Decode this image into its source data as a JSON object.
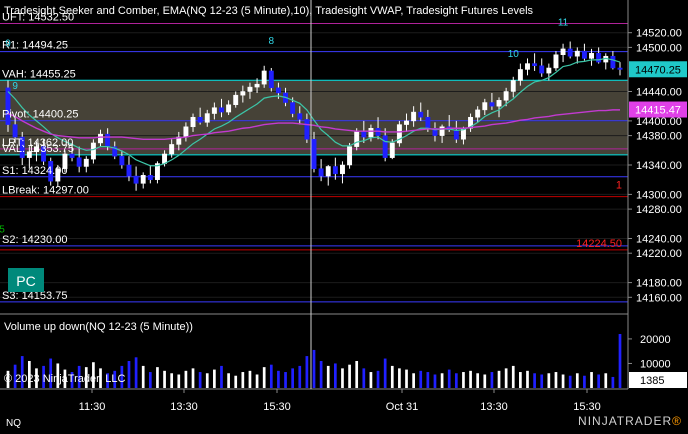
{
  "header": {
    "indicators": "Tradesight Seeker and Comber, EMA(NQ 12-23 (5 Minute),10), Tradesight VWAP, Tradesight Futures Levels"
  },
  "levels": [
    {
      "label": "UFT: 14532.50",
      "value": 14532.5,
      "color": "#b0229a"
    },
    {
      "label": "R1: 14494.25",
      "value": 14494.25,
      "color": "#3b3bff"
    },
    {
      "label": "VAH: 14455.25",
      "value": 14455.25,
      "color": "#00e5e5"
    },
    {
      "label": "Pivot: 14400.25",
      "value": 14400.25,
      "color": "#3b3bff"
    },
    {
      "label": "LRT: 14362.00",
      "value": 14362.0,
      "color": "#b0229a"
    },
    {
      "label": "VAL: 14353.75",
      "value": 14353.75,
      "color": "#00e5e5"
    },
    {
      "label": "S1: 14324.00",
      "value": 14324.0,
      "color": "#3b3bff"
    },
    {
      "label": "LBreak: 14297.00",
      "value": 14297.0,
      "color": "#c00000"
    },
    {
      "label": "S2: 14230.00",
      "value": 14230.0,
      "color": "#3b3bff"
    },
    {
      "label": "S3: 14153.75",
      "value": 14153.75,
      "color": "#3b3bff"
    }
  ],
  "price_axis": {
    "ticks": [
      "14520.00",
      "14500.00",
      "14440.00",
      "14400.00",
      "14380.00",
      "14340.00",
      "14300.00",
      "14280.00",
      "14240.00",
      "14220.00",
      "14180.00",
      "14160.00"
    ],
    "tick_values": [
      14520,
      14500,
      14440,
      14400,
      14380,
      14340,
      14300,
      14280,
      14240,
      14220,
      14180,
      14160
    ],
    "last_price_label": "14470.25",
    "last_price": 14470.25,
    "vwap_label": "14415.47",
    "vwap_value": 14415.47,
    "ylim": [
      14140,
      14540
    ]
  },
  "annotations": {
    "red_level_label": "14224.50",
    "red_level_value": 14224.5,
    "red_marker": "1",
    "counts": [
      "8",
      "10",
      "11",
      "9",
      "5",
      "9"
    ]
  },
  "volume_panel": {
    "title": "Volume up down(NQ 12-23 (5 Minute))",
    "ticks": [
      "20000",
      "10000"
    ],
    "tick_values": [
      20000,
      10000
    ],
    "last_volume": "1385",
    "ylim": [
      0,
      22000
    ]
  },
  "time_axis": {
    "labels": [
      "11:30",
      "13:30",
      "15:30",
      "Oct 31",
      "13:30",
      "15:30"
    ]
  },
  "footer": {
    "copyright": "© 2023 NinjaTrader, LLC",
    "instrument": "NQ",
    "logo_main": "NINJATRADER",
    "logo_mark": "®"
  },
  "buttons": {
    "pc": "PC"
  },
  "chart_data": {
    "type": "candlestick",
    "ylim": [
      14140,
      14540
    ],
    "ohlc": [
      [
        14445,
        14455,
        14385,
        14395
      ],
      [
        14395,
        14405,
        14370,
        14378
      ],
      [
        14378,
        14385,
        14340,
        14350
      ],
      [
        14350,
        14365,
        14335,
        14358
      ],
      [
        14358,
        14372,
        14345,
        14365
      ],
      [
        14365,
        14375,
        14340,
        14345
      ],
      [
        14345,
        14350,
        14312,
        14318
      ],
      [
        14318,
        14340,
        14310,
        14335
      ],
      [
        14335,
        14360,
        14330,
        14355
      ],
      [
        14355,
        14370,
        14345,
        14350
      ],
      [
        14350,
        14365,
        14330,
        14338
      ],
      [
        14338,
        14352,
        14330,
        14348
      ],
      [
        14348,
        14375,
        14342,
        14370
      ],
      [
        14370,
        14388,
        14365,
        14382
      ],
      [
        14382,
        14390,
        14360,
        14365
      ],
      [
        14365,
        14372,
        14348,
        14352
      ],
      [
        14352,
        14360,
        14335,
        14340
      ],
      [
        14340,
        14352,
        14318,
        14325
      ],
      [
        14325,
        14338,
        14305,
        14315
      ],
      [
        14315,
        14330,
        14308,
        14326
      ],
      [
        14326,
        14340,
        14315,
        14320
      ],
      [
        14320,
        14345,
        14315,
        14342
      ],
      [
        14342,
        14360,
        14338,
        14355
      ],
      [
        14355,
        14375,
        14350,
        14368
      ],
      [
        14368,
        14385,
        14360,
        14378
      ],
      [
        14378,
        14398,
        14372,
        14392
      ],
      [
        14392,
        14410,
        14385,
        14405
      ],
      [
        14405,
        14418,
        14395,
        14398
      ],
      [
        14398,
        14415,
        14392,
        14410
      ],
      [
        14410,
        14425,
        14402,
        14418
      ],
      [
        14418,
        14430,
        14405,
        14412
      ],
      [
        14412,
        14428,
        14408,
        14422
      ],
      [
        14422,
        14440,
        14418,
        14435
      ],
      [
        14435,
        14448,
        14425,
        14440
      ],
      [
        14440,
        14452,
        14430,
        14446
      ],
      [
        14446,
        14458,
        14438,
        14450
      ],
      [
        14450,
        14475,
        14445,
        14468
      ],
      [
        14468,
        14472,
        14440,
        14445
      ],
      [
        14445,
        14452,
        14430,
        14438
      ],
      [
        14438,
        14445,
        14420,
        14425
      ],
      [
        14425,
        14432,
        14405,
        14410
      ],
      [
        14410,
        14420,
        14395,
        14402
      ],
      [
        14402,
        14410,
        14370,
        14375
      ],
      [
        14375,
        14385,
        14330,
        14335
      ],
      [
        14335,
        14348,
        14318,
        14325
      ],
      [
        14325,
        14340,
        14312,
        14338
      ],
      [
        14338,
        14350,
        14320,
        14328
      ],
      [
        14328,
        14345,
        14315,
        14340
      ],
      [
        14340,
        14370,
        14335,
        14365
      ],
      [
        14365,
        14390,
        14360,
        14385
      ],
      [
        14385,
        14400,
        14370,
        14378
      ],
      [
        14378,
        14395,
        14372,
        14390
      ],
      [
        14390,
        14405,
        14375,
        14380
      ],
      [
        14380,
        14390,
        14345,
        14350
      ],
      [
        14350,
        14375,
        14348,
        14370
      ],
      [
        14370,
        14400,
        14365,
        14395
      ],
      [
        14395,
        14410,
        14385,
        14400
      ],
      [
        14400,
        14420,
        14392,
        14412
      ],
      [
        14412,
        14425,
        14400,
        14405
      ],
      [
        14405,
        14415,
        14385,
        14390
      ],
      [
        14390,
        14398,
        14372,
        14380
      ],
      [
        14380,
        14395,
        14370,
        14392
      ],
      [
        14392,
        14408,
        14385,
        14388
      ],
      [
        14388,
        14400,
        14370,
        14375
      ],
      [
        14375,
        14392,
        14368,
        14390
      ],
      [
        14390,
        14410,
        14385,
        14405
      ],
      [
        14405,
        14420,
        14398,
        14415
      ],
      [
        14415,
        14430,
        14408,
        14425
      ],
      [
        14425,
        14438,
        14415,
        14420
      ],
      [
        14420,
        14432,
        14405,
        14428
      ],
      [
        14428,
        14445,
        14420,
        14440
      ],
      [
        14440,
        14460,
        14432,
        14455
      ],
      [
        14455,
        14478,
        14448,
        14470
      ],
      [
        14470,
        14485,
        14462,
        14478
      ],
      [
        14478,
        14492,
        14468,
        14475
      ],
      [
        14475,
        14485,
        14460,
        14465
      ],
      [
        14465,
        14478,
        14455,
        14472
      ],
      [
        14472,
        14495,
        14468,
        14490
      ],
      [
        14490,
        14505,
        14480,
        14498
      ],
      [
        14498,
        14508,
        14485,
        14488
      ],
      [
        14488,
        14500,
        14478,
        14495
      ],
      [
        14495,
        14505,
        14482,
        14485
      ],
      [
        14485,
        14498,
        14475,
        14492
      ],
      [
        14492,
        14500,
        14478,
        14480
      ],
      [
        14480,
        14492,
        14470,
        14488
      ],
      [
        14488,
        14495,
        14470,
        14472
      ],
      [
        14472,
        14480,
        14462,
        14470
      ]
    ],
    "ema": [
      14440,
      14430,
      14418,
      14408,
      14400,
      14392,
      14383,
      14377,
      14372,
      14368,
      14363,
      14360,
      14361,
      14365,
      14365,
      14363,
      14359,
      14354,
      14347,
      14343,
      14339,
      14339,
      14342,
      14347,
      14353,
      14361,
      14369,
      14375,
      14382,
      14389,
      14393,
      14398,
      14405,
      14411,
      14417,
      14423,
      14431,
      14433,
      14434,
      14432,
      14428,
      14424,
      14415,
      14401,
      14388,
      14380,
      14371,
      14366,
      14366,
      14371,
      14373,
      14377,
      14378,
      14372,
      14371,
      14375,
      14380,
      14386,
      14390,
      14390,
      14388,
      14389,
      14389,
      14387,
      14388,
      14392,
      14398,
      14406,
      14411,
      14415,
      14423,
      14430,
      14439,
      14447,
      14453,
      14455,
      14459,
      14466,
      14474,
      14476,
      14480,
      14481,
      14483,
      14483,
      14485,
      14483,
      14480
    ],
    "vwap": [
      14410,
      14406,
      14400,
      14395,
      14390,
      14386,
      14382,
      14380,
      14379,
      14378,
      14377,
      14377,
      14377,
      14378,
      14378,
      14378,
      14378,
      14377,
      14376,
      14375,
      14375,
      14375,
      14375,
      14376,
      14377,
      14378,
      14380,
      14381,
      14382,
      14384,
      14385,
      14386,
      14388,
      14390,
      14391,
      14393,
      14395,
      14396,
      14397,
      14397,
      14397,
      14396,
      14395,
      14394,
      14392,
      14391,
      14389,
      14388,
      14387,
      14386,
      14386,
      14386,
      14386,
      14385,
      14385,
      14385,
      14386,
      14387,
      14388,
      14389,
      14389,
      14389,
      14390,
      14390,
      14390,
      14391,
      14392,
      14393,
      14395,
      14396,
      14397,
      14399,
      14401,
      14402,
      14404,
      14405,
      14406,
      14408,
      14409,
      14410,
      14411,
      14412,
      14413,
      14414,
      14414,
      14415,
      14415
    ],
    "volume": [
      7000,
      9500,
      13000,
      11000,
      8000,
      9000,
      12000,
      10000,
      7500,
      6500,
      9000,
      8500,
      10500,
      8000,
      6000,
      7000,
      9000,
      11000,
      12500,
      9000,
      6500,
      8500,
      7000,
      6000,
      5500,
      7000,
      8000,
      6500,
      6000,
      7500,
      9000,
      6000,
      5000,
      6500,
      7000,
      5500,
      8500,
      9500,
      7000,
      6500,
      8000,
      9000,
      13000,
      15500,
      11000,
      9000,
      10000,
      8000,
      9500,
      11000,
      8000,
      6500,
      7000,
      12000,
      9000,
      8000,
      7500,
      6000,
      7000,
      6500,
      5500,
      6000,
      7500,
      6000,
      6500,
      7000,
      6000,
      5500,
      6500,
      7000,
      8000,
      9000,
      6500,
      7000,
      6000,
      5500,
      6000,
      6500,
      5500,
      5000,
      6000,
      5000,
      6500,
      5500,
      6000,
      4500,
      22000
    ],
    "volume_up": [
      true,
      false,
      false,
      true,
      true,
      false,
      false,
      true,
      true,
      false,
      false,
      true,
      true,
      true,
      false,
      false,
      false,
      false,
      false,
      true,
      false,
      true,
      true,
      true,
      true,
      true,
      true,
      false,
      true,
      true,
      false,
      true,
      true,
      true,
      true,
      true,
      true,
      false,
      false,
      false,
      false,
      false,
      false,
      false,
      false,
      true,
      false,
      true,
      true,
      true,
      false,
      true,
      false,
      false,
      true,
      true,
      true,
      true,
      false,
      false,
      false,
      true,
      false,
      false,
      true,
      true,
      true,
      true,
      false,
      true,
      true,
      true,
      true,
      true,
      false,
      false,
      true,
      true,
      true,
      false,
      true,
      false,
      true,
      false,
      true,
      false,
      false
    ]
  }
}
